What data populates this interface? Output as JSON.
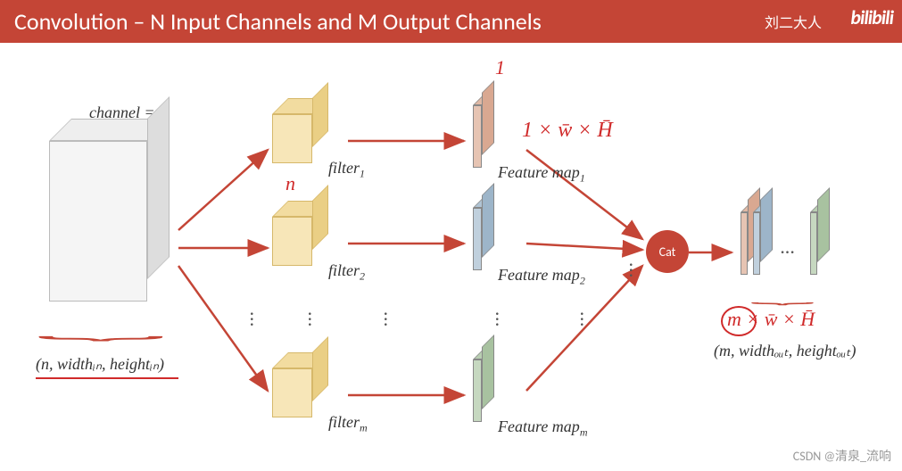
{
  "header": {
    "title": "Convolution – N Input Channels and M Output Channels"
  },
  "watermarks": {
    "author": "刘二大人",
    "logo": "bilibili",
    "footer": "CSDN @清泉_流响"
  },
  "input": {
    "channel_label": "channel = n",
    "shape_label": "(n, widthᵢₙ, heightᵢₙ)"
  },
  "filters": {
    "label_prefix": "filter",
    "indices": [
      "1",
      "2",
      "m"
    ],
    "hand_n": "n"
  },
  "feature_maps": {
    "label_prefix": "Feature map",
    "indices": [
      "1",
      "2",
      "m"
    ],
    "hand_one": "1",
    "hand_dims": "1 × w̄ × H̄"
  },
  "cat": {
    "label": "Cat"
  },
  "output": {
    "shape_label": "(m, widthₒᵤₜ, heightₒᵤₜ)",
    "hand_dims": "m × w̄ × H̄",
    "hand_m": "m"
  },
  "colors": {
    "accent": "#c44536",
    "plate1": "#d9a891",
    "plate2": "#9db5c9",
    "plate3": "#a8c2a0",
    "filter": "#f7e6b8"
  }
}
